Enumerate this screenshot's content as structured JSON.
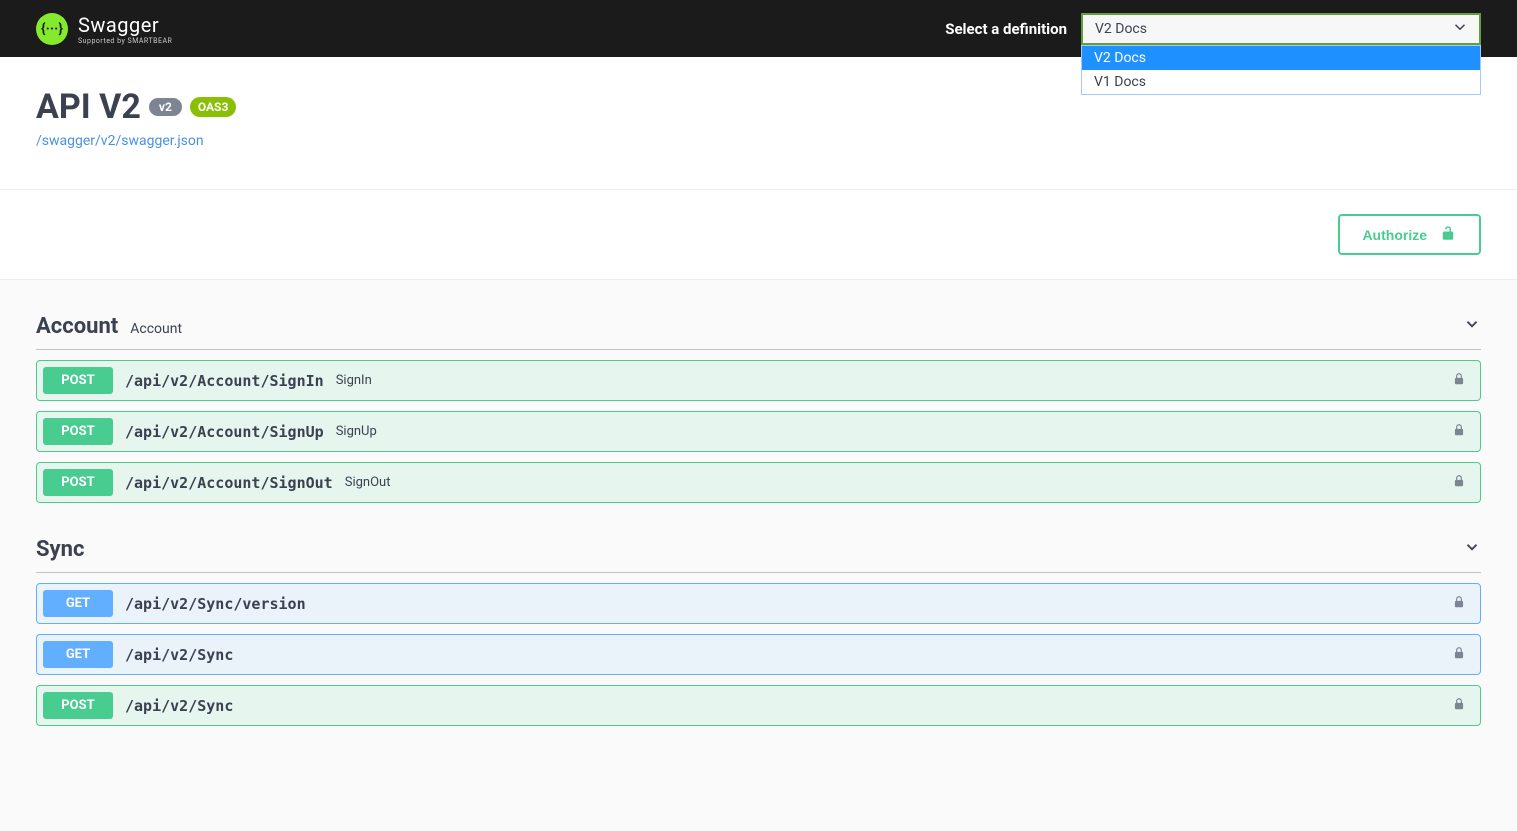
{
  "topbar": {
    "brand": "Swagger",
    "tagline": "Supported by SMARTBEAR",
    "select_label": "Select a definition",
    "selected": "V2 Docs",
    "options": [
      "V2 Docs",
      "V1 Docs"
    ]
  },
  "info": {
    "title": "API V2",
    "version": "v2",
    "oas": "OAS3",
    "spec_url": "/swagger/v2/swagger.json"
  },
  "authorize": {
    "label": "Authorize"
  },
  "tags": [
    {
      "name": "Account",
      "description": "Account",
      "ops": [
        {
          "method": "POST",
          "path": "/api/v2/Account/SignIn",
          "summary": "SignIn"
        },
        {
          "method": "POST",
          "path": "/api/v2/Account/SignUp",
          "summary": "SignUp"
        },
        {
          "method": "POST",
          "path": "/api/v2/Account/SignOut",
          "summary": "SignOut"
        }
      ]
    },
    {
      "name": "Sync",
      "description": "",
      "ops": [
        {
          "method": "GET",
          "path": "/api/v2/Sync/version",
          "summary": ""
        },
        {
          "method": "GET",
          "path": "/api/v2/Sync",
          "summary": ""
        },
        {
          "method": "POST",
          "path": "/api/v2/Sync",
          "summary": ""
        }
      ]
    }
  ]
}
